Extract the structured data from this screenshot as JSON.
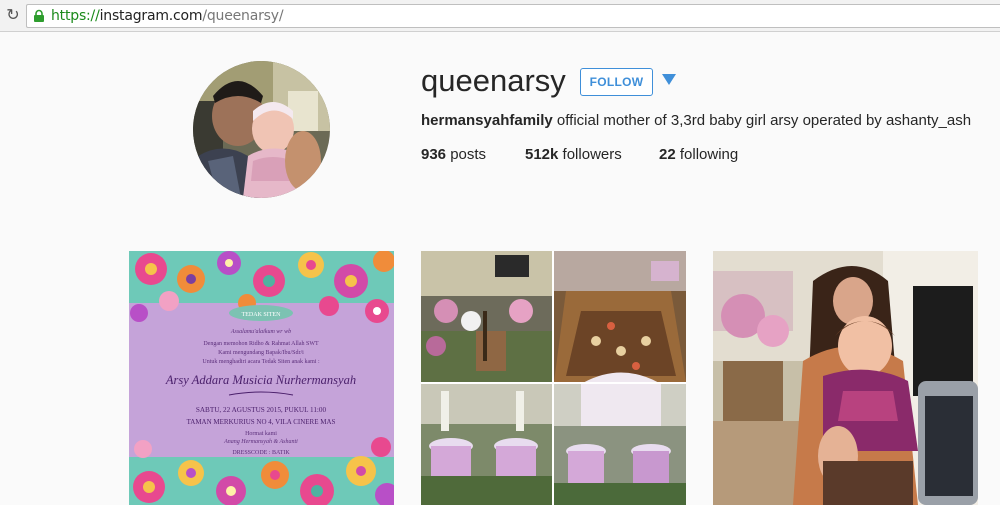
{
  "browser": {
    "url_scheme": "https://",
    "url_host": "instagram.com",
    "url_path": "/queenarsy/",
    "reload_icon": "reload-icon",
    "lock_icon": "lock-icon"
  },
  "profile": {
    "username": "queenarsy",
    "follow_label": "FOLLOW",
    "bio_name": "hermansyahfamily",
    "bio_text": "official mother of 3,3rd baby girl arsy operated by ashanty_ash",
    "posts_count": "936",
    "posts_label": "posts",
    "followers_count": "512k",
    "followers_label": "followers",
    "following_count": "22",
    "following_label": "following"
  },
  "posts": [
    {
      "kind": "invitation",
      "badge": "TEDAK SITEN",
      "line1": "Assalamu'alaikum wr wb",
      "line2": "Dengan memohon Ridho & Rahmat Allah SWT",
      "line3": "Kami mengundang Bapak/Ibu/Sdr/i",
      "line4": "Untuk menghadiri acara Tedak Siten anak kami :",
      "name": "Arsy Addara Musicia Nurhermansyah",
      "date": "SABTU, 22 AGUSTUS 2015, PUKUL 11:00",
      "place": "TAMAN MERKURIUS NO 4, VILA CINERE MAS",
      "host1": "Hormat kami",
      "host2": "Anang Hermansyah & Ashanti",
      "dresscode": "DRESSCODE : BATIK"
    },
    {
      "kind": "collage"
    },
    {
      "kind": "photo"
    }
  ],
  "colors": {
    "accent": "#3f8fd9",
    "text": "#262626",
    "background": "#fafafa",
    "invitation_bg": "#c5a3d9",
    "url_scheme": "#1a8a1a"
  }
}
